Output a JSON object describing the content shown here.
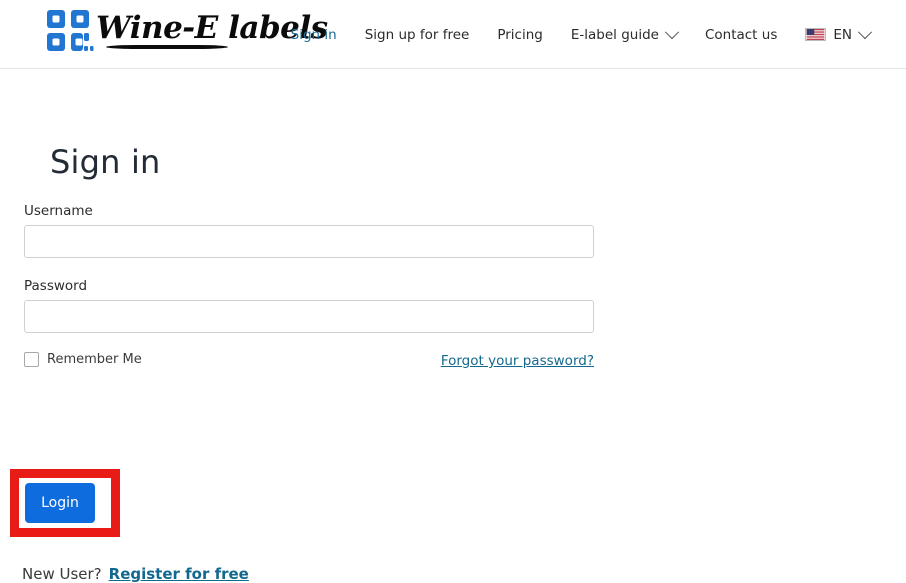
{
  "header": {
    "logo": {
      "mark_icon": "qr-code-icon",
      "wordmark": "Wine-E labels",
      "mark_color": "#2176d2"
    },
    "nav": [
      {
        "label": "Sign in",
        "icon": null,
        "active": true,
        "has_caret": false
      },
      {
        "label": "Sign up for free",
        "icon": null,
        "active": false,
        "has_caret": false
      },
      {
        "label": "Pricing",
        "icon": null,
        "active": false,
        "has_caret": false
      },
      {
        "label": "E-label guide",
        "icon": "chevron-down-icon",
        "active": false,
        "has_caret": true
      },
      {
        "label": "Contact us",
        "icon": null,
        "active": false,
        "has_caret": false
      }
    ],
    "language": {
      "label": "EN",
      "flag_icon": "us-flag-icon",
      "caret_icon": "chevron-down-icon"
    }
  },
  "main": {
    "title": "Sign in",
    "form": {
      "username": {
        "label": "Username",
        "value": "",
        "placeholder": ""
      },
      "password": {
        "label": "Password",
        "value": "",
        "placeholder": ""
      },
      "remember_me": {
        "label": "Remember Me",
        "checked": false
      },
      "forgot_password_label": "Forgot your password?",
      "login_button_label": "Login"
    },
    "footer": {
      "new_user_text": "New User?",
      "register_link_label": "Register for free"
    }
  },
  "colors": {
    "primary_button": "#0f6cdf",
    "link": "#13688f",
    "nav_active": "#1a6a96",
    "annotation": "#e81b17",
    "brand_mark": "#2176d2"
  }
}
